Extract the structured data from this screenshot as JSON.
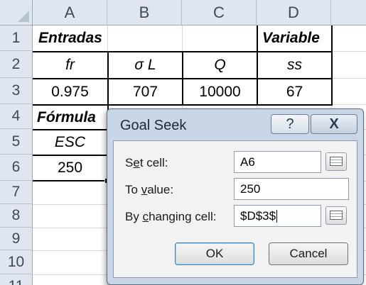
{
  "columns": [
    "A",
    "B",
    "C",
    "D"
  ],
  "rows": [
    "1",
    "2",
    "3",
    "4",
    "5",
    "6",
    "7",
    "8",
    "9",
    "10",
    "11"
  ],
  "cells": {
    "A1": "Entradas",
    "D1": "Variable",
    "A2": "fr",
    "B2": "σ L",
    "C2": "Q",
    "D2": "ss",
    "A3": "0.975",
    "B3": "707",
    "C3": "10000",
    "D3": "67",
    "A4": "Fórmula",
    "A5": "ESC",
    "A6": "250"
  },
  "dialog": {
    "title": "Goal Seek",
    "help_label": "?",
    "close_label": "X",
    "set_cell_label_pre": "S",
    "set_cell_label_ul": "e",
    "set_cell_label_post": "t cell:",
    "set_cell_value": "A6",
    "to_value_label_pre": "To ",
    "to_value_label_ul": "v",
    "to_value_label_post": "alue:",
    "to_value_value": "250",
    "changing_label_pre": "By ",
    "changing_label_ul": "c",
    "changing_label_post": "hanging cell:",
    "changing_value": "$D$3$",
    "ok_label": "OK",
    "cancel_label": "Cancel"
  }
}
